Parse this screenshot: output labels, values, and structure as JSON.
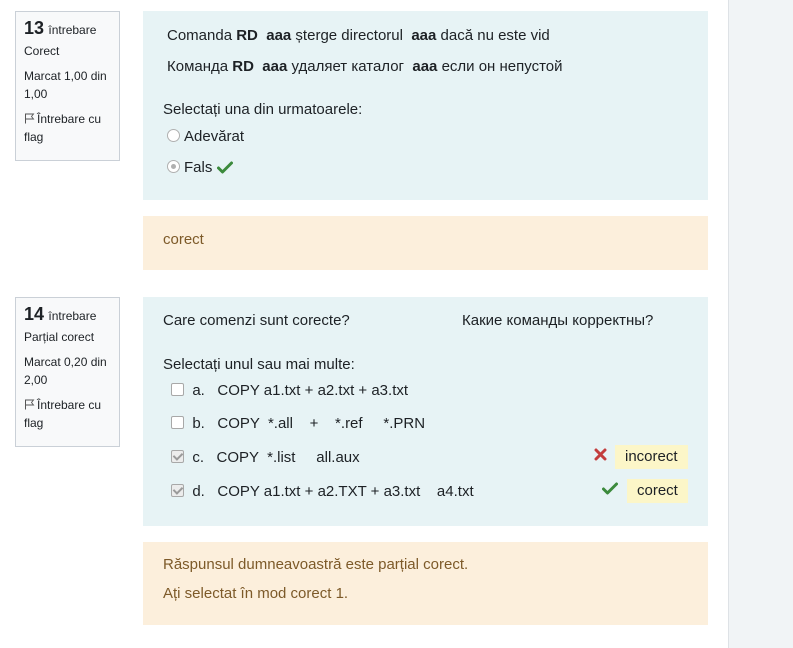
{
  "q13": {
    "number": "13",
    "word": "întrebare",
    "state": "Corect",
    "grade_line1": "Marcat 1,00 din",
    "grade_line2": "1,00",
    "flag_line1": "Întrebare cu",
    "flag_line2": "flag",
    "text_ro": {
      "pre": "Comanda ",
      "cmd": "RD",
      "arg1": "aaa",
      "mid": " șterge directorul ",
      "arg2": "aaa",
      "post": " dacă nu este vid"
    },
    "text_ru": {
      "pre": "Команда ",
      "cmd": "RD",
      "arg1": "aaa",
      "mid": " удаляет каталог ",
      "arg2": "aaa",
      "post": " если он непустой"
    },
    "prompt": "Selectați una din urmatoarele:",
    "options": [
      {
        "label": "Adevărat",
        "selected": false
      },
      {
        "label": "Fals",
        "selected": true,
        "mark": "correct"
      }
    ],
    "feedback": "corect"
  },
  "q14": {
    "number": "14",
    "word": "întrebare",
    "state": "Parțial corect",
    "grade_line1": "Marcat 0,20 din",
    "grade_line2": "2,00",
    "flag_line1": "Întrebare cu",
    "flag_line2": "flag",
    "text_ro": "Care comenzi sunt corecte?",
    "text_ru": "Какие команды корректны?",
    "prompt": "Selectați unul sau mai multe:",
    "options": [
      {
        "letter": "a.",
        "text": "COPY a1.txt + a2.txt + a3.txt",
        "checked": false
      },
      {
        "letter": "b.",
        "text": "COPY  *.all    +    *.ref     *.PRN",
        "checked": false
      },
      {
        "letter": "c.",
        "text": "COPY  *.list     all.aux",
        "checked": true,
        "mark": "incorrect",
        "badge": "incorect"
      },
      {
        "letter": "d.",
        "text": "COPY a1.txt + a2.TXT + a3.txt    a4.txt",
        "checked": true,
        "mark": "correct",
        "badge": "corect"
      }
    ],
    "feedback_line1": "Răspunsul dumneavoastră este parțial corect.",
    "feedback_line2": "Ați selectat în mod corect 1."
  },
  "colors": {
    "correct": "#3c8a3c",
    "incorrect": "#c33d3d",
    "formulation_bg": "#e7f3f5",
    "feedback_bg": "#fcefdc",
    "badge_bg": "#fcf6c8"
  }
}
